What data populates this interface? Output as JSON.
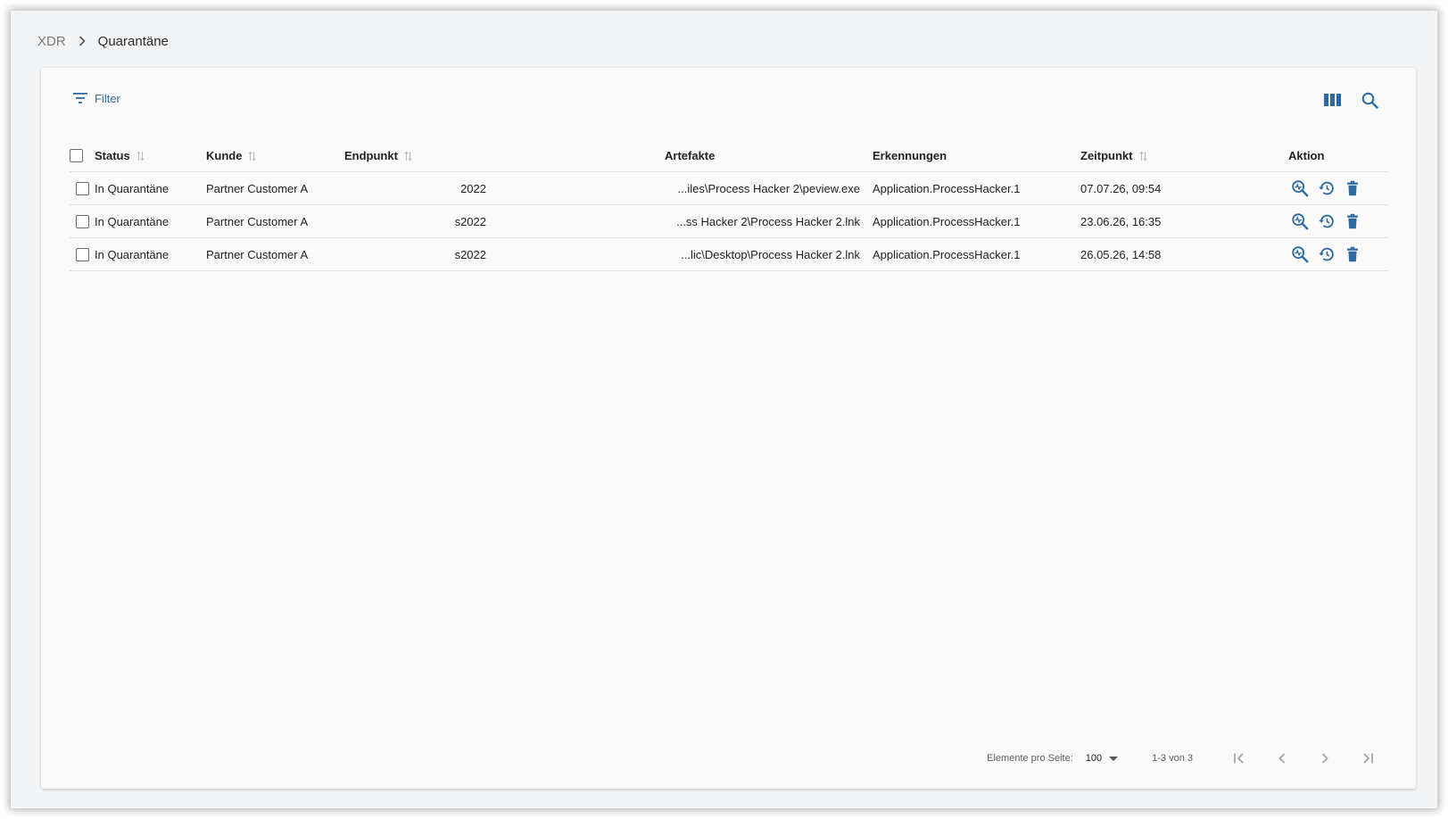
{
  "breadcrumb": {
    "root": "XDR",
    "current": "Quarantäne"
  },
  "toolbar": {
    "filter_label": "Filter",
    "icons": [
      "filter-icon",
      "columns-icon",
      "search-icon"
    ]
  },
  "table": {
    "columns": [
      "Status",
      "Kunde",
      "Endpunkt",
      "Artefakte",
      "Erkennungen",
      "Zeitpunkt",
      "Aktion"
    ],
    "sortable": [
      "Status",
      "Kunde",
      "Endpunkt",
      "Zeitpunkt"
    ],
    "rows": [
      {
        "status": "In Quarantäne",
        "customer": "Partner Customer A",
        "endpoint": "2022",
        "artifact": "...iles\\Process Hacker 2\\peview.exe",
        "detection": "Application.ProcessHacker.1",
        "time": "07.07.26, 09:54"
      },
      {
        "status": "In Quarantäne",
        "customer": "Partner Customer A",
        "endpoint": "s2022",
        "artifact": "...ss Hacker 2\\Process Hacker 2.lnk",
        "detection": "Application.ProcessHacker.1",
        "time": "23.06.26, 16:35"
      },
      {
        "status": "In Quarantäne",
        "customer": "Partner Customer A",
        "endpoint": "s2022",
        "artifact": "...lic\\Desktop\\Process Hacker 2.lnk",
        "detection": "Application.ProcessHacker.1",
        "time": "26.05.26, 14:58"
      }
    ],
    "row_action_icons": [
      "analyze-icon",
      "restore-icon",
      "delete-icon"
    ]
  },
  "paginator": {
    "items_per_page_label": "Elemente pro Seite:",
    "page_size": "100",
    "range_label": "1-3 von 3"
  },
  "colors": {
    "accent": "#2d6aa3",
    "page_bg": "#f3f4f6",
    "card_bg": "#fafafa",
    "sort_arrow": "#b9b9b9"
  }
}
